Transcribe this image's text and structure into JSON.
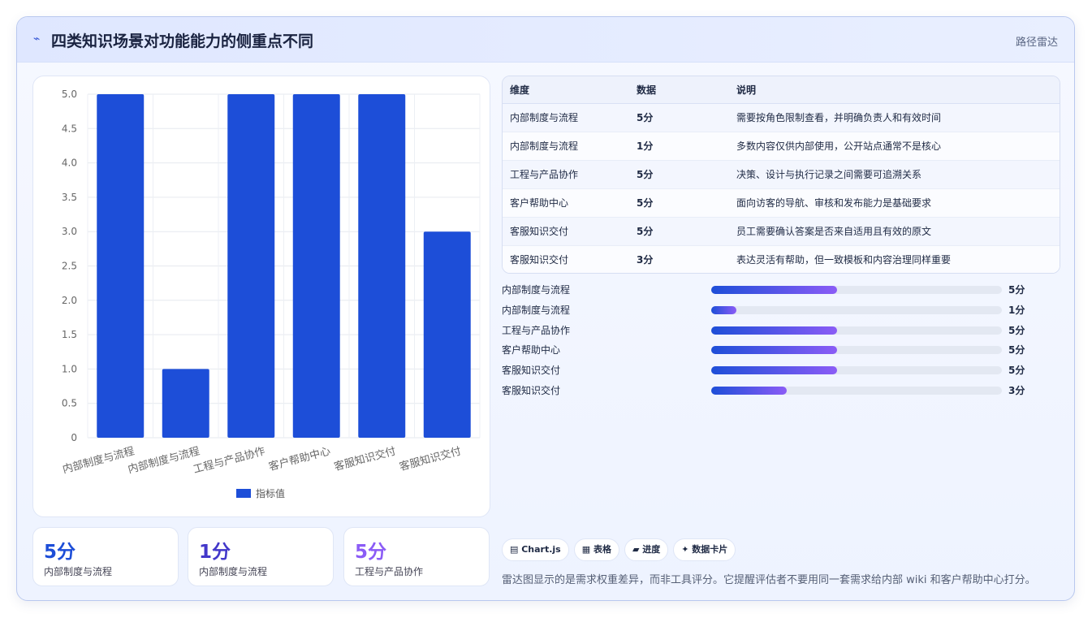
{
  "header": {
    "icon": "⌁",
    "title": "四类知识场景对功能能力的侧重点不同",
    "tag": "路径雷达"
  },
  "chart_data": {
    "type": "bar",
    "categories": [
      "内部制度与流程",
      "内部制度与流程",
      "工程与产品协作",
      "客户帮助中心",
      "客服知识交付",
      "客服知识交付"
    ],
    "series": [
      {
        "name": "指标值",
        "values": [
          5,
          1,
          5,
          5,
          5,
          3
        ]
      }
    ],
    "ylim": [
      0,
      5
    ],
    "yticks": [
      "0",
      "0.5",
      "1.0",
      "1.5",
      "2.0",
      "2.5",
      "3.0",
      "3.5",
      "4.0",
      "4.5",
      "5.0"
    ],
    "grid": true,
    "legend": "bottom",
    "color": "#1d4ed8"
  },
  "stats": [
    {
      "value": "5分",
      "label": "内部制度与流程",
      "color": "#1d4ed8"
    },
    {
      "value": "1分",
      "label": "内部制度与流程",
      "color": "#4338ca"
    },
    {
      "value": "5分",
      "label": "工程与产品协作",
      "color": "#8b5cf6"
    }
  ],
  "table": {
    "headers": [
      "维度",
      "数据",
      "说明"
    ],
    "rows": [
      [
        "内部制度与流程",
        "5分",
        "需要按角色限制查看，并明确负责人和有效时间"
      ],
      [
        "内部制度与流程",
        "1分",
        "多数内容仅供内部使用，公开站点通常不是核心"
      ],
      [
        "工程与产品协作",
        "5分",
        "决策、设计与执行记录之间需要可追溯关系"
      ],
      [
        "客户帮助中心",
        "5分",
        "面向访客的导航、审核和发布能力是基础要求"
      ],
      [
        "客服知识交付",
        "5分",
        "员工需要确认答案是否来自适用且有效的原文"
      ],
      [
        "客服知识交付",
        "3分",
        "表达灵活有帮助，但一致模板和内容治理同样重要"
      ]
    ]
  },
  "progress": [
    {
      "label": "内部制度与流程",
      "value": "5分",
      "fraction": 0.433
    },
    {
      "label": "内部制度与流程",
      "value": "1分",
      "fraction": 0.087
    },
    {
      "label": "工程与产品协作",
      "value": "5分",
      "fraction": 0.433
    },
    {
      "label": "客户帮助中心",
      "value": "5分",
      "fraction": 0.433
    },
    {
      "label": "客服知识交付",
      "value": "5分",
      "fraction": 0.433
    },
    {
      "label": "客服知识交付",
      "value": "3分",
      "fraction": 0.26
    }
  ],
  "chips": [
    "▤ Chart.js",
    "▦ 表格",
    "▰ 进度",
    "✦ 数据卡片"
  ],
  "footer_note": "雷达图显示的是需求权重差异，而非工具评分。它提醒评估者不要用同一套需求给内部 wiki 和客户帮助中心打分。"
}
